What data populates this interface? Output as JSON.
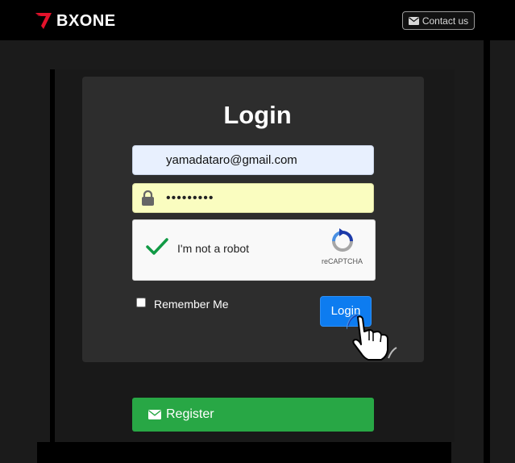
{
  "header": {
    "logo_text": "BXONE",
    "contact_label": "Contact us"
  },
  "login": {
    "title": "Login",
    "email_value": "yamadataro@gmail.com",
    "password_mask": "•••••••••",
    "recaptcha_label": "I'm not a robot",
    "recaptcha_brand": "reCAPTCHA",
    "remember_label": "Remember Me",
    "login_button": "Login",
    "register_button": "Register"
  },
  "colors": {
    "login_blue": "#0d7cf0",
    "register_green": "#28a745",
    "logo_red": "#e3122b",
    "autofill_yellow": "#fafdc0"
  },
  "icons": [
    "bxone-logo-icon",
    "envelope-icon",
    "lock-icon",
    "checkmark-icon",
    "recaptcha-icon",
    "hand-pointer-icon"
  ]
}
